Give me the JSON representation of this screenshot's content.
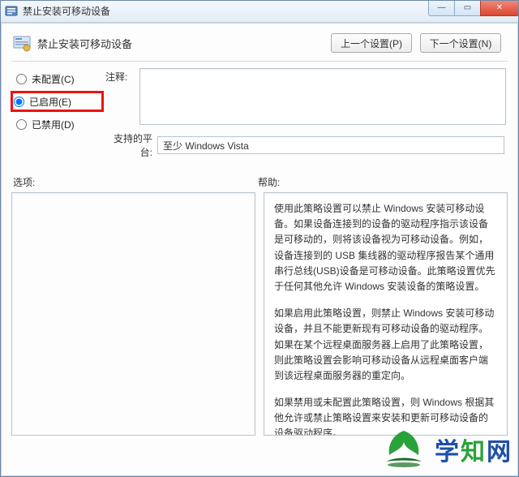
{
  "window": {
    "title": "禁止安装可移动设备"
  },
  "header": {
    "policy_title": "禁止安装可移动设备",
    "prev_btn": "上一个设置(P)",
    "next_btn": "下一个设置(N)"
  },
  "radios": {
    "not_configured": "未配置(C)",
    "enabled": "已启用(E)",
    "disabled": "已禁用(D)",
    "selected": "enabled"
  },
  "comment": {
    "label": "注释:",
    "value": ""
  },
  "platform": {
    "label": "支持的平台:",
    "value": "至少 Windows Vista"
  },
  "sections": {
    "options": "选项:",
    "help": "帮助:"
  },
  "help": {
    "p1": "使用此策略设置可以禁止 Windows 安装可移动设备。如果设备连接到的设备的驱动程序指示该设备是可移动的，则将该设备视为可移动设备。例如，设备连接到的 USB 集线器的驱动程序报告某个通用串行总线(USB)设备是可移动设备。此策略设置优先于任何其他允许 Windows 安装设备的策略设置。",
    "p2": "如果启用此策略设置，则禁止 Windows 安装可移动设备，并且不能更新现有可移动设备的驱动程序。如果在某个远程桌面服务器上启用了此策略设置，则此策略设置会影响可移动设备从远程桌面客户端到该远程桌面服务器的重定向。",
    "p3": "如果禁用或未配置此策略设置，则 Windows 根据其他允许或禁止策略设置来安装和更新可移动设备的设备驱动程序。"
  },
  "watermark": {
    "t1": "学",
    "t2": "知",
    "t3": "网"
  }
}
